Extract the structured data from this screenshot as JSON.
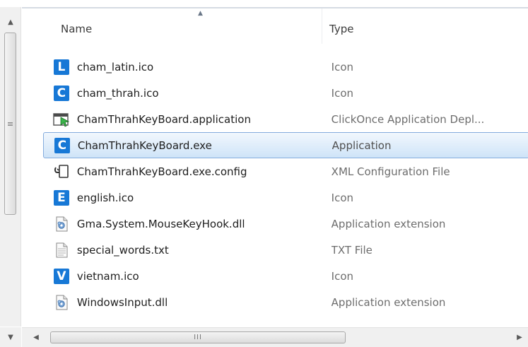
{
  "header": {
    "name_label": "Name",
    "type_label": "Type"
  },
  "files": [
    {
      "name": "cham_latin.ico",
      "type": "Icon",
      "icon": "letter-l-icon",
      "letter": "L"
    },
    {
      "name": "cham_thrah.ico",
      "type": "Icon",
      "icon": "letter-c-icon",
      "letter": "C"
    },
    {
      "name": "ChamThrahKeyBoard.application",
      "type": "ClickOnce Application Depl...",
      "icon": "clickonce-application-icon"
    },
    {
      "name": "ChamThrahKeyBoard.exe",
      "type": "Application",
      "icon": "letter-c-icon",
      "letter": "C",
      "selected": true
    },
    {
      "name": "ChamThrahKeyBoard.exe.config",
      "type": "XML Configuration File",
      "icon": "config-file-icon"
    },
    {
      "name": "english.ico",
      "type": "Icon",
      "icon": "letter-e-icon",
      "letter": "E"
    },
    {
      "name": "Gma.System.MouseKeyHook.dll",
      "type": "Application extension",
      "icon": "dll-file-icon"
    },
    {
      "name": "special_words.txt",
      "type": "TXT File",
      "icon": "text-file-icon"
    },
    {
      "name": "vietnam.ico",
      "type": "Icon",
      "icon": "letter-v-icon",
      "letter": "V"
    },
    {
      "name": "WindowsInput.dll",
      "type": "Application extension",
      "icon": "dll-file-icon"
    }
  ],
  "colors": {
    "accent_icon": "#1778d6",
    "selection_border": "#84acdd"
  }
}
